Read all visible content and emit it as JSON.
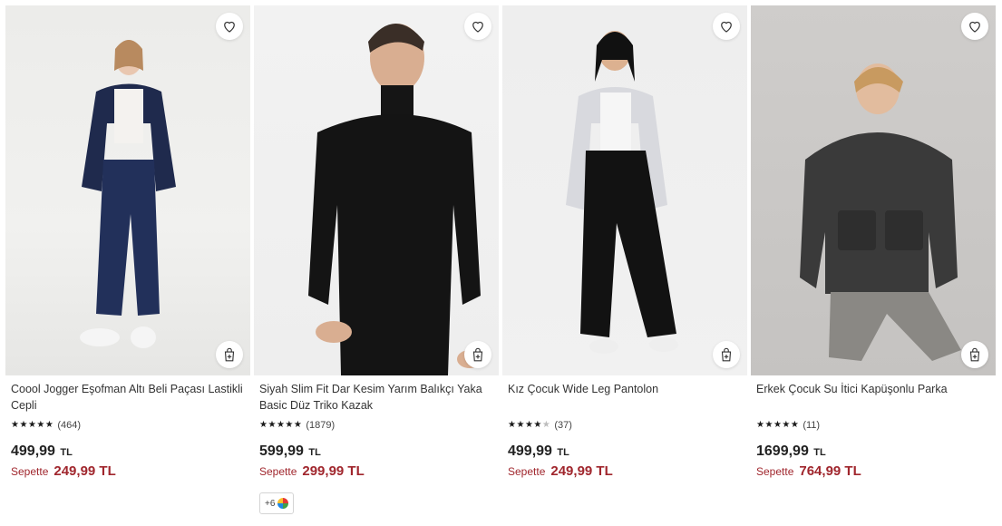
{
  "currency": "TL",
  "sale_label": "Sepette",
  "products": [
    {
      "title": "Coool Jogger Eşofman Altı Beli Paçası Lastikli Cepli",
      "rating": 5,
      "review_count": "(464)",
      "price": "499,99",
      "sale_price": "249,99 TL",
      "image_icon": "product-photo-navy-tracksuit"
    },
    {
      "title": "Siyah Slim Fit Dar Kesim Yarım Balıkçı Yaka Basic Düz Triko Kazak",
      "rating": 5,
      "review_count": "(1879)",
      "price": "599,99",
      "sale_price": "299,99 TL",
      "extra_colors": "+6",
      "image_icon": "product-photo-black-sweater"
    },
    {
      "title": "Kız Çocuk Wide Leg Pantolon",
      "rating": 4,
      "review_count": "(37)",
      "price": "499,99",
      "sale_price": "249,99 TL",
      "image_icon": "product-photo-wide-leg-pants"
    },
    {
      "title": "Erkek Çocuk Su İtici Kapüşonlu Parka",
      "rating": 5,
      "review_count": "(11)",
      "price": "1699,99",
      "sale_price": "764,99 TL",
      "image_icon": "product-photo-grey-parka"
    }
  ],
  "colors": {
    "sale": "#a0262d",
    "text": "#222222",
    "star": "#1a1a1a"
  }
}
